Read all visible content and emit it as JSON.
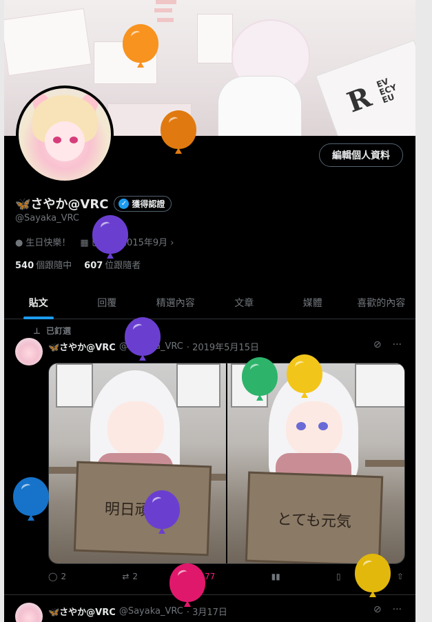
{
  "profile": {
    "name": "🦋さやか@VRC",
    "verified_label": "獲得認證",
    "handle": "@Sayaka_VRC",
    "location": "生日快樂！",
    "joined": "已加入 2015年9月",
    "following_count": "540",
    "following_label": "個跟隨中",
    "followers_count": "607",
    "followers_label": "位跟隨者",
    "edit_button": "編輯個人資料"
  },
  "banner": {
    "logo_text": "R",
    "logo_small": "EV\nECY\nEU"
  },
  "tabs": [
    {
      "label": "貼文",
      "active": true
    },
    {
      "label": "回覆"
    },
    {
      "label": "精選內容"
    },
    {
      "label": "文章"
    },
    {
      "label": "媒體"
    },
    {
      "label": "喜歡的內容"
    }
  ],
  "pinned_label": "已釘選",
  "posts": [
    {
      "name": "🦋さやか@VRC",
      "handle": "@Sayaka_VRC",
      "date": "· 2019年5月15日",
      "images": [
        {
          "sign_text": "明日頑張る"
        },
        {
          "sign_text": "とても元気"
        }
      ],
      "replies": "2",
      "reposts": "2",
      "likes": "77"
    },
    {
      "name": "🦋さやか@VRC",
      "handle": "@Sayaka_VRC",
      "date": "· 3月17日"
    }
  ],
  "icons": {
    "location": "location-pin-icon",
    "calendar": "calendar-icon",
    "more": "more-icon",
    "grok": "grok-icon"
  },
  "colors": {
    "accent": "#1d9bf0",
    "like": "#f91880",
    "balloons": [
      "#f7931e",
      "#e07a10",
      "#6a3fd0",
      "#6a3fd0",
      "#2eb36b",
      "#f2c51a",
      "#1673c9",
      "#6a3fd0",
      "#e0186c",
      "#e2b80c"
    ]
  }
}
